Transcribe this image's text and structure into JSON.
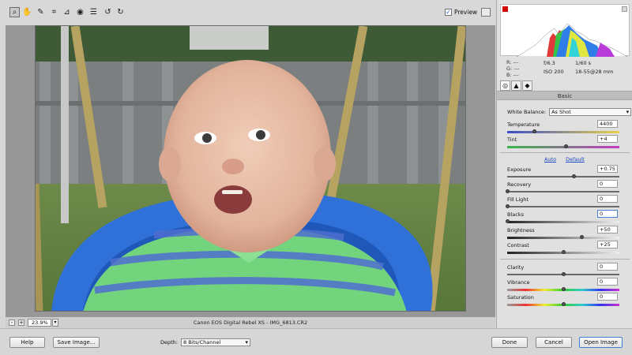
{
  "toolbar": {
    "tools": [
      "zoom-tool",
      "hand-tool",
      "white-balance-tool",
      "crop-tool",
      "straighten-tool",
      "red-eye-tool",
      "preferences-tool",
      "rotate-left-tool",
      "rotate-right-tool"
    ],
    "preview_label": "Preview",
    "preview_checked": true
  },
  "image_bar": {
    "zoom_out": "-",
    "zoom_in": "+",
    "zoom_value": "23.9%",
    "caption": "Canon EOS Digital Rebel XS  -  IMG_6813.CR2"
  },
  "info": {
    "r": "R:  ---",
    "g": "G:  ---",
    "b": "B:  ---",
    "aperture": "f/6.3",
    "shutter": "1/60 s",
    "iso": "ISO 200",
    "lens": "18-55@28 mm"
  },
  "panel": {
    "section_title": "Basic",
    "white_balance_label": "White Balance:",
    "white_balance_value": "As Shot",
    "auto_link": "Auto",
    "default_link": "Default",
    "sliders": {
      "temperature": {
        "label": "Temperature",
        "value": "4400",
        "position": 0.24
      },
      "tint": {
        "label": "Tint",
        "value": "+4",
        "position": 0.52
      },
      "exposure": {
        "label": "Exposure",
        "value": "+0.75",
        "position": 0.59
      },
      "recovery": {
        "label": "Recovery",
        "value": "0",
        "position": 0.0
      },
      "fill_light": {
        "label": "Fill Light",
        "value": "0",
        "position": 0.0
      },
      "blacks": {
        "label": "Blacks",
        "value": "0",
        "position": 0.0
      },
      "brightness": {
        "label": "Brightness",
        "value": "+50",
        "position": 0.66
      },
      "contrast": {
        "label": "Contrast",
        "value": "+25",
        "position": 0.5
      },
      "clarity": {
        "label": "Clarity",
        "value": "0",
        "position": 0.5
      },
      "vibrance": {
        "label": "Vibrance",
        "value": "0",
        "position": 0.5
      },
      "saturation": {
        "label": "Saturation",
        "value": "0",
        "position": 0.5
      }
    }
  },
  "footer": {
    "help": "Help",
    "save_image": "Save Image...",
    "depth_label": "Depth:",
    "depth_value": "8 Bits/Channel",
    "done": "Done",
    "cancel": "Cancel",
    "open_image": "Open Image"
  }
}
